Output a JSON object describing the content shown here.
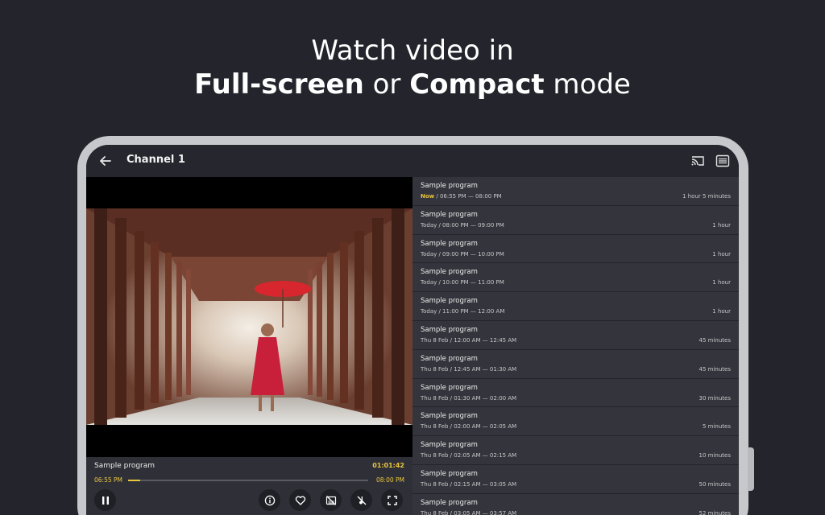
{
  "headline": {
    "line1": "Watch video in",
    "line2_bold1": "Full-screen",
    "line2_mid": " or ",
    "line2_bold2": "Compact",
    "line2_end": " mode"
  },
  "app": {
    "channel_title": "Channel 1",
    "icons": [
      "back-arrow-icon",
      "cast-icon",
      "tv-guide-icon"
    ]
  },
  "player": {
    "program_title": "Sample program",
    "remaining": "01:01:42",
    "start_time": "06:55 PM",
    "end_time": "08:00 PM",
    "progress": 0.05,
    "accent_color": "#e9c53c",
    "buttons": [
      "pause-icon",
      "info-icon",
      "favorite-icon",
      "subtitles-off-icon",
      "audio-off-icon",
      "fullscreen-icon"
    ]
  },
  "schedule": [
    {
      "name": "Sample program",
      "now": "Now",
      "time": " / 06:55 PM — 08:00 PM",
      "duration": "1 hour 5 minutes"
    },
    {
      "name": "Sample program",
      "time": "Today / 08:00 PM — 09:00 PM",
      "duration": "1 hour"
    },
    {
      "name": "Sample program",
      "time": "Today / 09:00 PM — 10:00 PM",
      "duration": "1 hour"
    },
    {
      "name": "Sample program",
      "time": "Today / 10:00 PM — 11:00 PM",
      "duration": "1 hour"
    },
    {
      "name": "Sample program",
      "time": "Today / 11:00 PM — 12:00 AM",
      "duration": "1 hour"
    },
    {
      "name": "Sample program",
      "time": "Thu 8 Feb / 12:00 AM — 12:45 AM",
      "duration": "45 minutes"
    },
    {
      "name": "Sample program",
      "time": "Thu 8 Feb / 12:45 AM — 01:30 AM",
      "duration": "45 minutes"
    },
    {
      "name": "Sample program",
      "time": "Thu 8 Feb / 01:30 AM — 02:00 AM",
      "duration": "30 minutes"
    },
    {
      "name": "Sample program",
      "time": "Thu 8 Feb / 02:00 AM — 02:05 AM",
      "duration": "5 minutes"
    },
    {
      "name": "Sample program",
      "time": "Thu 8 Feb / 02:05 AM — 02:15 AM",
      "duration": "10 minutes"
    },
    {
      "name": "Sample program",
      "time": "Thu 8 Feb / 02:15 AM — 03:05 AM",
      "duration": "50 minutes"
    },
    {
      "name": "Sample program",
      "time": "Thu 8 Feb / 03:05 AM — 03:57 AM",
      "duration": "52 minutes"
    }
  ]
}
